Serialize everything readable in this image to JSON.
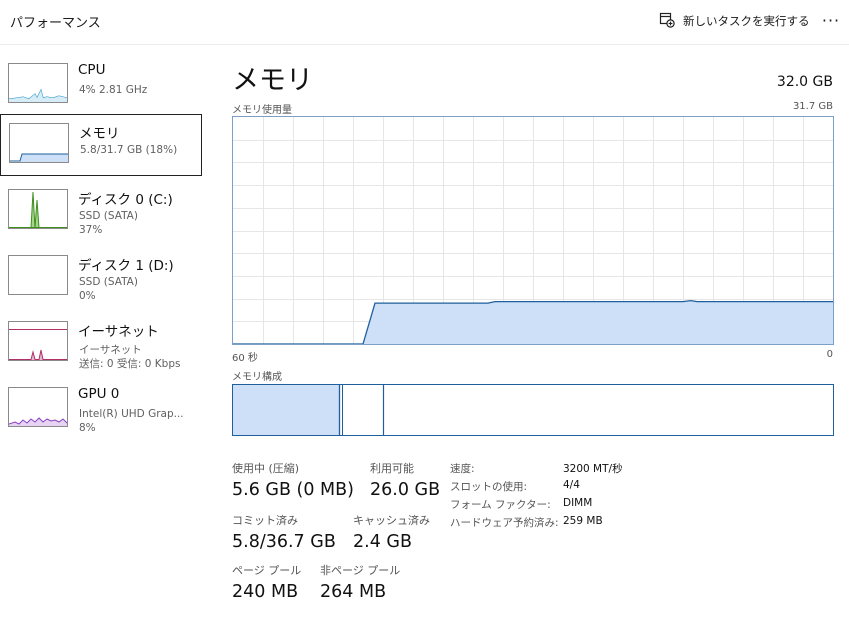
{
  "header": {
    "title": "パフォーマンス",
    "new_task_label": "新しいタスクを実行する",
    "more_label": "···"
  },
  "sidebar": {
    "items": [
      {
        "name": "CPU",
        "line2": "4%  2.81 GHz",
        "line3": ""
      },
      {
        "name": "メモリ",
        "line2": "5.8/31.7 GB (18%)",
        "line3": ""
      },
      {
        "name": "ディスク 0 (C:)",
        "line2": "SSD (SATA)",
        "line3": "37%"
      },
      {
        "name": "ディスク 1 (D:)",
        "line2": "SSD (SATA)",
        "line3": "0%"
      },
      {
        "name": "イーサネット",
        "line2": "イーサネット",
        "line3": "送信: 0 受信: 0 Kbps"
      },
      {
        "name": "GPU 0",
        "line2": "Intel(R) UHD Grap...",
        "line3": "8%"
      }
    ]
  },
  "main": {
    "title": "メモリ",
    "capacity": "32.0 GB",
    "usage_label": "メモリ使用量",
    "usage_max": "31.7 GB",
    "time_left": "60 秒",
    "time_right": "0",
    "composition_label": "メモリ構成",
    "usage_fraction": 0.18,
    "colors": {
      "graph_fill": "#cde0f7",
      "graph_line": "#1f5f9e",
      "grid": "#e6e6e6",
      "border": "#7b9fc6"
    }
  },
  "stats": {
    "in_use_label": "使用中 (圧縮)",
    "in_use_value": "5.6 GB (0 MB)",
    "available_label": "利用可能",
    "available_value": "26.0 GB",
    "committed_label": "コミット済み",
    "committed_value": "5.8/36.7 GB",
    "cached_label": "キャッシュ済み",
    "cached_value": "2.4 GB",
    "paged_label": "ページ プール",
    "paged_value": "240 MB",
    "nonpaged_label": "非ページ プール",
    "nonpaged_value": "264 MB"
  },
  "details": {
    "speed_label": "速度:",
    "speed_value": "3200 MT/秒",
    "slots_label": "スロットの使用:",
    "slots_value": "4/4",
    "form_label": "フォーム ファクター:",
    "form_value": "DIMM",
    "reserved_label": "ハードウェア予約済み:",
    "reserved_value": "259 MB"
  }
}
